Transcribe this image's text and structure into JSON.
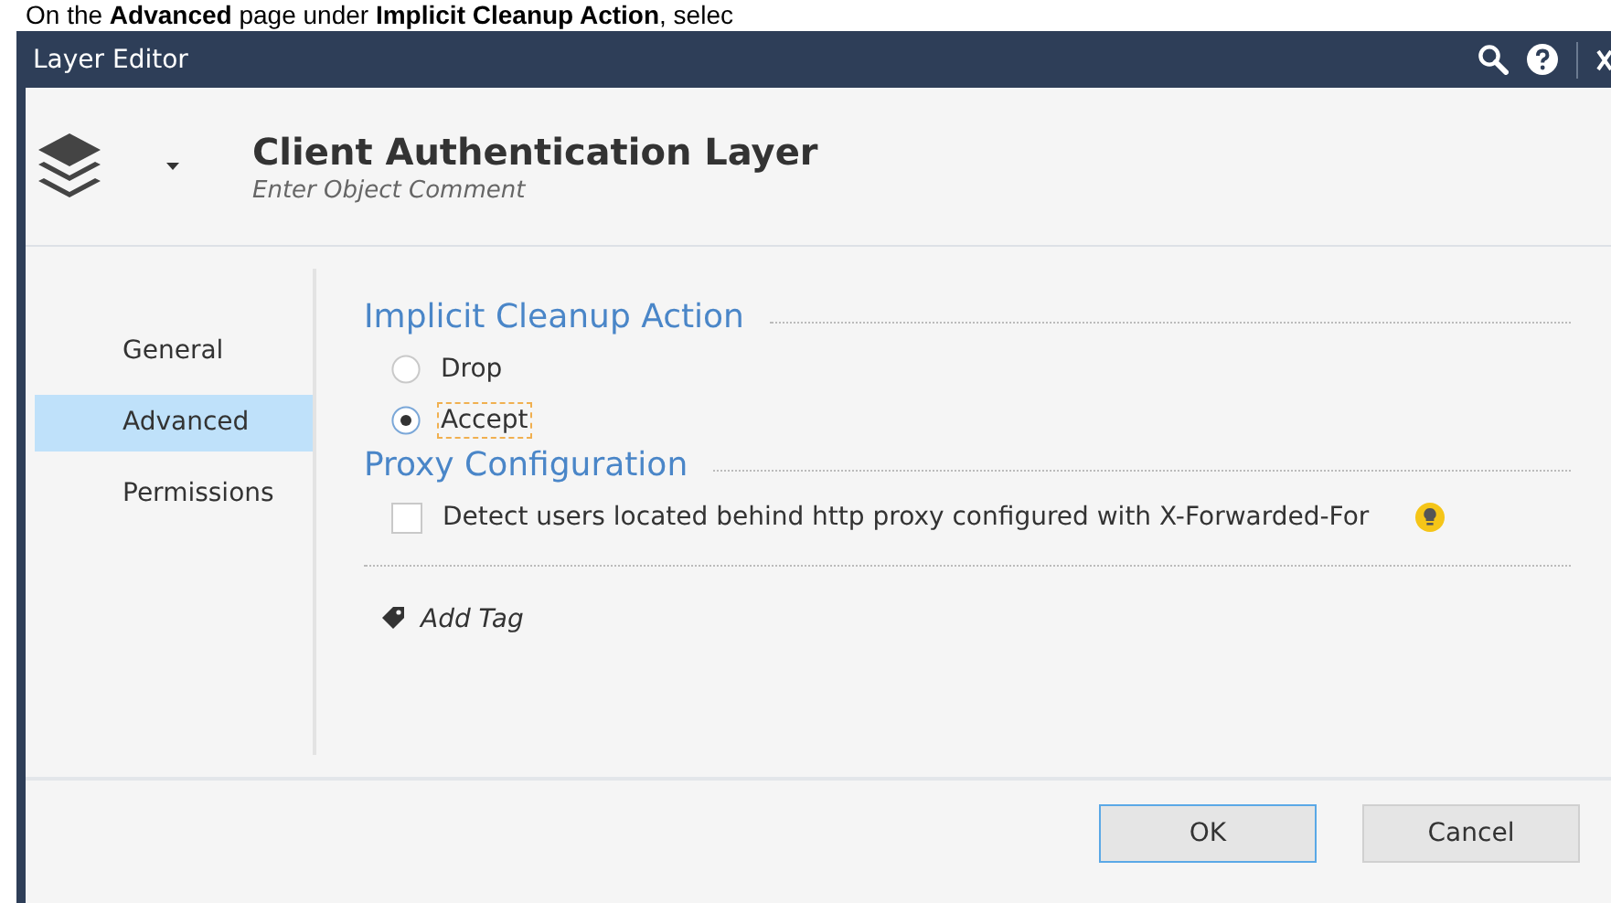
{
  "document_text": "On the **Advanced** page under **Implicit Cleanup Action**, selec",
  "window": {
    "title": "Layer Editor"
  },
  "header": {
    "name": "Client Authentication Layer",
    "comment_placeholder": "Enter Object Comment"
  },
  "sidebar": {
    "items": [
      {
        "label": "General",
        "selected": false
      },
      {
        "label": "Advanced",
        "selected": true
      },
      {
        "label": "Permissions",
        "selected": false
      }
    ]
  },
  "sections": [
    {
      "title": "Implicit Cleanup Action",
      "kind": "radio",
      "options": [
        {
          "label": "Drop",
          "selected": false,
          "focused": false
        },
        {
          "label": "Accept",
          "selected": true,
          "focused": true
        }
      ]
    },
    {
      "title": "Proxy Configuration",
      "kind": "checkbox",
      "options": [
        {
          "label": "Detect users located behind http proxy configured with X-Forwarded-For",
          "checked": false,
          "hint": true
        }
      ]
    }
  ],
  "add_tag": "Add Tag",
  "buttons": [
    {
      "label": "OK",
      "default": true
    },
    {
      "label": "Cancel",
      "default": false
    }
  ]
}
